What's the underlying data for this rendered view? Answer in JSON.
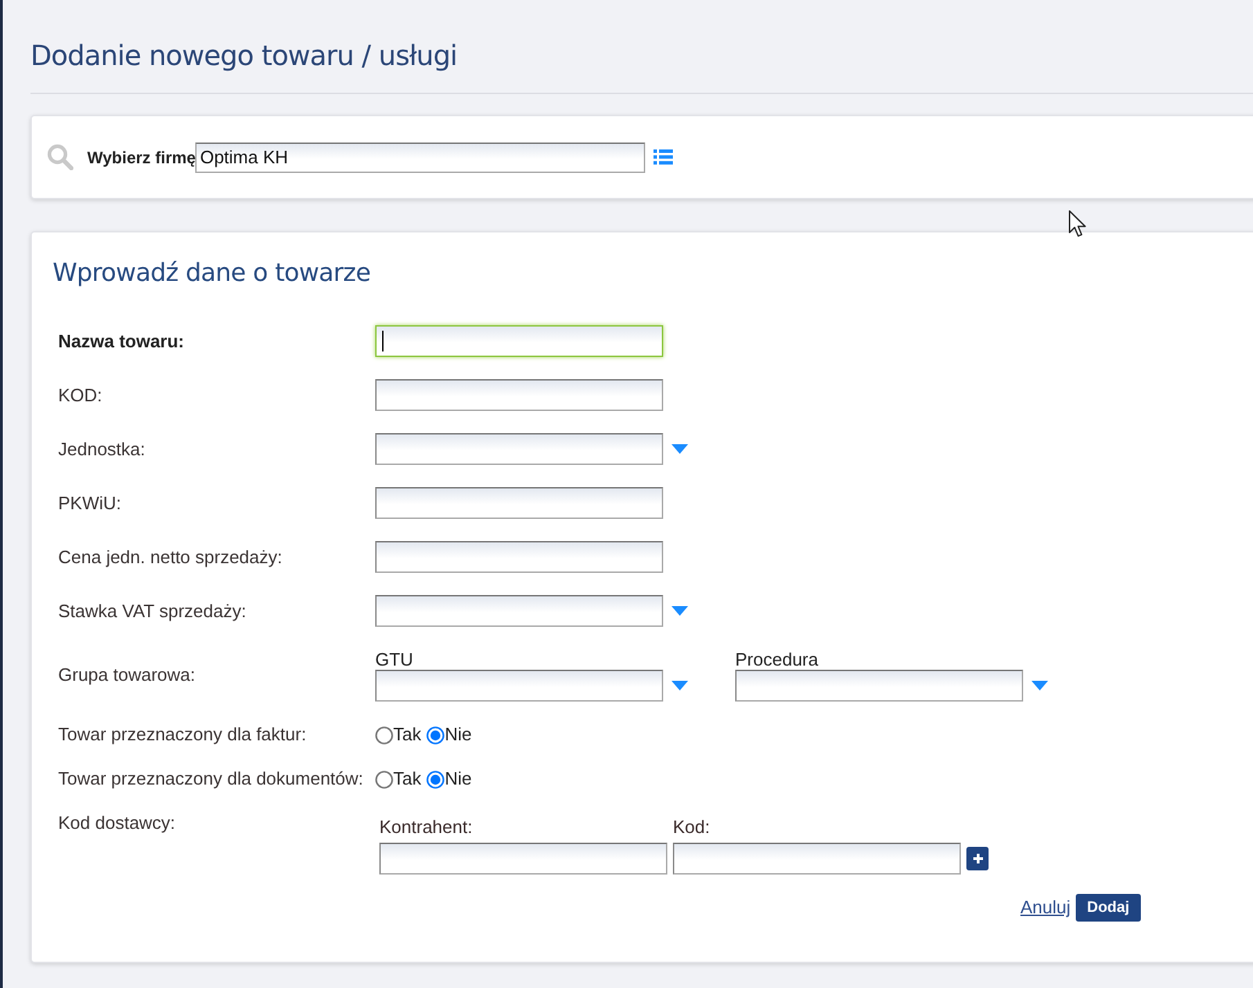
{
  "page_title": "Dodanie nowego towaru / usługi",
  "company_picker": {
    "label": "Wybierz firmę",
    "value": "Optima KH"
  },
  "form": {
    "title": "Wprowadź dane o towarze",
    "fields": [
      {
        "kind": "text",
        "label": "Nazwa towaru:",
        "bold": true,
        "focused": true
      },
      {
        "kind": "text",
        "label": "KOD:",
        "bold": false,
        "focused": false
      },
      {
        "kind": "select",
        "label": "Jednostka:",
        "bold": false,
        "focused": false
      },
      {
        "kind": "text",
        "label": "PKWiU:",
        "bold": false,
        "focused": false
      },
      {
        "kind": "text",
        "label": "Cena jedn. netto sprzedaży:",
        "bold": false,
        "focused": false
      },
      {
        "kind": "select",
        "label": "Stawka VAT sprzedaży:",
        "bold": false,
        "focused": false
      },
      {
        "kind": "select_group",
        "label": "Grupa towarowa:",
        "bold": false,
        "selects": [
          {
            "label": "GTU"
          },
          {
            "label": "Procedura"
          }
        ]
      },
      {
        "kind": "radio",
        "label": "Towar przeznaczony dla faktur:",
        "bold": false,
        "options": [
          {
            "label": "Tak",
            "selected": false
          },
          {
            "label": "Nie",
            "selected": true
          }
        ]
      },
      {
        "kind": "radio",
        "label": "Towar przeznaczony dla dokumentów:",
        "bold": false,
        "options": [
          {
            "label": "Tak",
            "selected": false
          },
          {
            "label": "Nie",
            "selected": true
          }
        ]
      },
      {
        "kind": "input_group",
        "label": "Kod dostawcy:",
        "bold": false,
        "inputs": [
          {
            "label": "Kontrahent:"
          },
          {
            "label": "Kod:"
          }
        ]
      }
    ],
    "actions": {
      "cancel": "Anuluj",
      "submit": "Dodaj"
    }
  }
}
